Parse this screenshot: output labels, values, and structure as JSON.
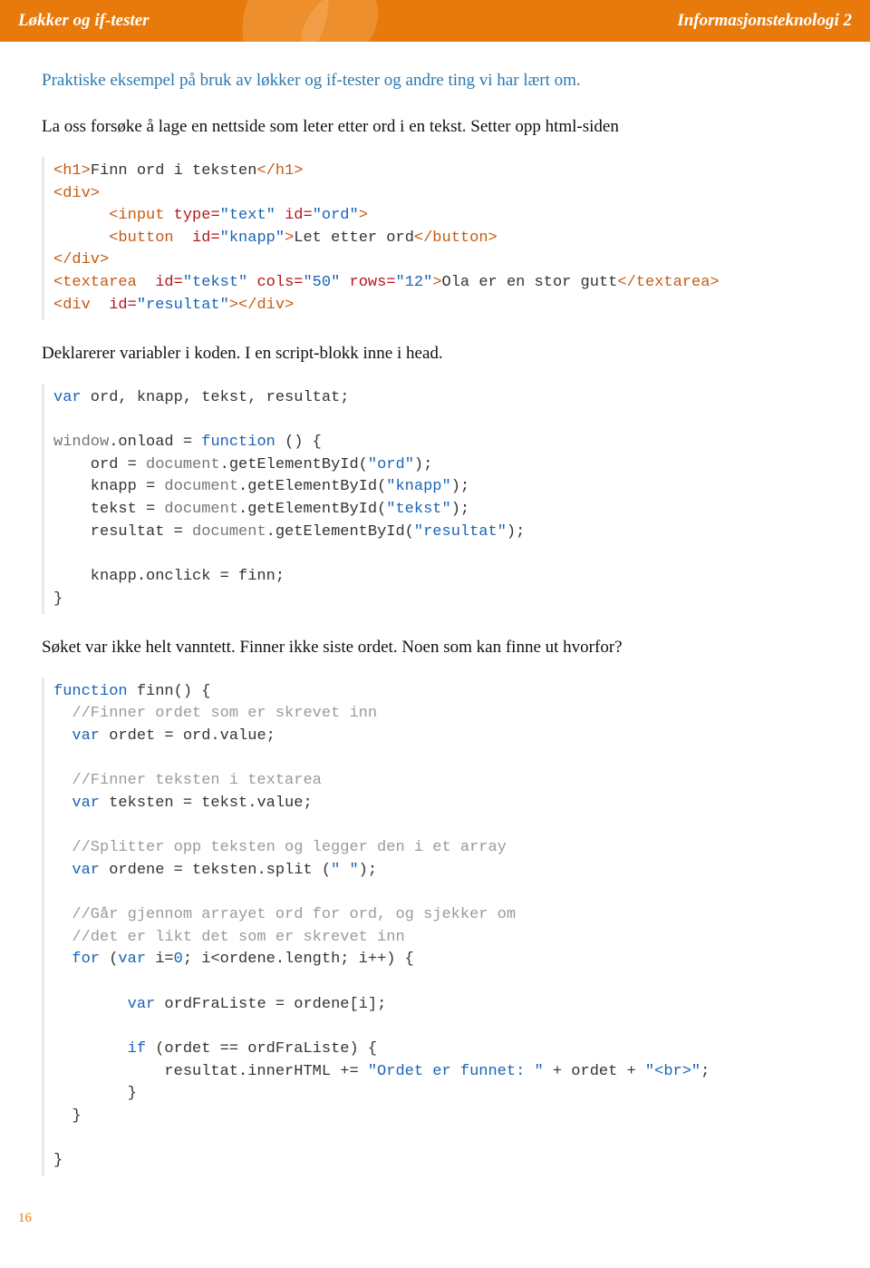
{
  "header": {
    "left": "Løkker og if-tester",
    "right": "Informasjonsteknologi 2"
  },
  "intro": "Praktiske eksempel på bruk av løkker og if-tester og andre ting vi har lært om.",
  "para1": "La oss forsøke å lage en nettside som leter etter ord i en tekst. Setter opp html-siden",
  "para2": "Deklarerer variabler i koden. I en script-blokk inne i  head.",
  "para3": "Søket var ikke helt vanntett. Finner ikke siste ordet. Noen som kan finne ut hvorfor?",
  "code1": {
    "h1_open": "<h1>",
    "h1_txt": "Finn ord i teksten",
    "h1_close": "</h1>",
    "div_open": "<div>",
    "div_close": "</div>",
    "indent": "      ",
    "input": "<input ",
    "type_k": "type=",
    "type_v": "\"text\"",
    "id_k": " id=",
    "ord_v": "\"ord\"",
    "gt": ">",
    "button_open": "<button ",
    "knapp_v": "\"knapp\"",
    "button_txt": "Let etter ord",
    "button_close": "</button>",
    "textarea_open": "<textarea ",
    "tekst_v": "\"tekst\"",
    "cols_k": " cols=",
    "cols_v": "\"50\"",
    "rows_k": " rows=",
    "rows_v": "\"12\"",
    "textarea_txt": "Ola er en stor gutt",
    "textarea_close": "</textarea>",
    "divres": "<div ",
    "res_v": "\"resultat\"",
    "divres_close": "></div>"
  },
  "code2": {
    "var": "var",
    "decl": " ord, knapp, tekst, resultat;",
    "win": "window",
    "onload": ".onload = ",
    "func": "function",
    "paren": " () {",
    "l1a": "    ord = ",
    "doc": "document",
    "ge": ".getElementById(",
    "s_ord": "\"ord\"",
    "end": ");",
    "l2a": "    knapp = ",
    "s_knapp": "\"knapp\"",
    "l3a": "    tekst = ",
    "s_tekst": "\"tekst\"",
    "l4a": "    resultat = ",
    "s_res": "\"resultat\"",
    "l5": "    knapp.onclick = finn;",
    "close": "}"
  },
  "code3": {
    "func": "function",
    "name": " finn() {",
    "c1": "  //Finner ordet som er skrevet inn",
    "var": "var",
    "l1": " ordet = ord.value;",
    "c2": "  //Finner teksten i textarea",
    "l2": " teksten = tekst.value;",
    "c3": "  //Splitter opp teksten og legger den i et array",
    "l3a": " ordene = teksten.split (",
    "sp": "\" \"",
    "l3b": ");",
    "c4": "  //Går gjennom arrayet ord for ord, og sjekker om",
    "c5": "  //det er likt det som er skrevet inn",
    "for": "for",
    "fopen": " (",
    "fvar": "var",
    "fi": " i=",
    "zero": "0",
    "fcond": "; i<ordene.length; i++) {",
    "l4": " ordFraListe = ordene[i];",
    "if": "if",
    "ifc": " (ordet == ordFraListe) {",
    "l5a": "            resultat.innerHTML += ",
    "str1": "\"Ordet er funnet: \"",
    "plus": " + ordet + ",
    "str2": "\"<br>\"",
    "semi": ";",
    "cb": "        }",
    "cb2": "  }",
    "cb3": "}"
  },
  "pagenum": "16"
}
